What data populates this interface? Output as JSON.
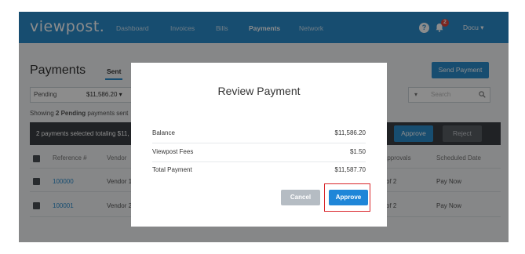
{
  "nav": {
    "logo": "viewpost.",
    "links": [
      "Dashboard",
      "Invoices",
      "Bills",
      "Payments",
      "Network"
    ],
    "active": "Payments",
    "notification_count": "2",
    "user": "Docu ▾"
  },
  "page": {
    "title": "Payments",
    "tab": "Sent",
    "send_button": "Send Payment",
    "filter": {
      "status": "Pending",
      "amount": "$11,586.20 ▾"
    },
    "search_placeholder": "Search",
    "showing_prefix": "Showing ",
    "showing_bold": "2 Pending",
    "showing_suffix": " payments sent",
    "selection_text": "2 payments selected totaling $11,",
    "approve_label": "Approve",
    "reject_label": "Reject",
    "columns": {
      "reference": "Reference #",
      "vendor": "Vendor",
      "approvals": "Approvals",
      "scheduled": "Scheduled Date"
    },
    "rows": [
      {
        "reference": "100000",
        "vendor": "Vendor 1",
        "approvals": "of 2",
        "scheduled": "Pay Now"
      },
      {
        "reference": "100001",
        "vendor": "Vendor 2",
        "approvals": "of 2",
        "scheduled": "Pay Now"
      }
    ]
  },
  "modal": {
    "title": "Review Payment",
    "balance_label": "Balance",
    "balance_value": "$11,586.20",
    "fees_label": "Viewpost Fees",
    "fees_value": "$1.50",
    "total_label": "Total Payment",
    "total_value": "$11,587.70",
    "cancel_label": "Cancel",
    "approve_label": "Approve"
  },
  "colors": {
    "brand": "#2a8ccd",
    "highlight": "#d9262b",
    "selection_bar": "#3b3f44"
  }
}
